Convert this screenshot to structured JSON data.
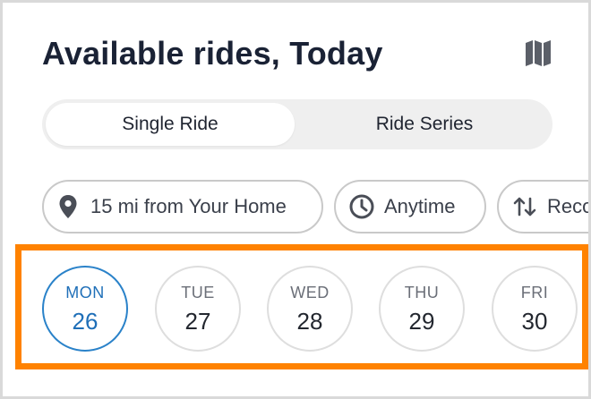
{
  "header": {
    "title": "Available rides, Today",
    "map_icon": "map-icon"
  },
  "ride_type": {
    "options": [
      {
        "label": "Single Ride",
        "selected": true
      },
      {
        "label": "Ride Series",
        "selected": false
      }
    ]
  },
  "filters": {
    "distance": {
      "label": "15 mi from Your Home",
      "icon": "location-pin-icon"
    },
    "time": {
      "label": "Anytime",
      "icon": "clock-icon"
    },
    "sort": {
      "label": "Recommended",
      "icon": "sort-arrows-icon"
    }
  },
  "dates": [
    {
      "dow": "MON",
      "day": "26",
      "selected": true
    },
    {
      "dow": "TUE",
      "day": "27",
      "selected": false
    },
    {
      "dow": "WED",
      "day": "28",
      "selected": false
    },
    {
      "dow": "THU",
      "day": "29",
      "selected": false
    },
    {
      "dow": "FRI",
      "day": "30",
      "selected": false
    }
  ],
  "colors": {
    "accent": "#1f6fb8",
    "highlight": "#ff8200",
    "title": "#1a2235"
  }
}
